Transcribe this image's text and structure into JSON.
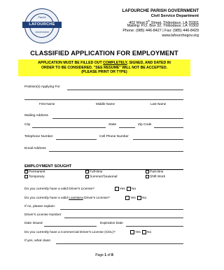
{
  "header": {
    "seal": {
      "top_text": "Parish",
      "band_text": "LAFOURCHE",
      "bottom_text": "Government"
    },
    "org_name": "LAFOURCHE PARISH GOVERNMENT",
    "dept": "Civil Service Department",
    "address1": "402 West 5",
    "address1_sup": "th",
    "address1_rest": " Street, Thibodaux, LA 70301",
    "address2": "Mailing: P.O. Box 32, Thibodaux, LA 70302",
    "phone": "Phone: (985) 446-8427 | Fax: (985) 446-8429",
    "web": "www.lafourchegov.org"
  },
  "title": "CLASSIFIED APPLICATION FOR EMPLOYMENT",
  "notice": {
    "line1_a": "APPLICATION MUST BE FILLED OUT ",
    "line1_u": "COMPLETELY",
    "line1_b": ", SIGNED, AND DATED IN",
    "line2": "ORDER TO BE CONSIDERED. \"SEE RESUME\" WILL NOT BE ACCEPTED.",
    "line3": "(PLEASE PRINT OR TYPE)"
  },
  "fields": {
    "positions": "Position(s) Applying For",
    "first_name": "First Name",
    "middle_name": "Middle Name",
    "last_name": "Last Name",
    "mailing_address": "Mailing Address",
    "city": "City",
    "state": "State",
    "zip": "Zip Code",
    "telephone": "Telephone Number",
    "cell": "Cell Phone Number",
    "email": "Email Address"
  },
  "employment": {
    "heading": "EMPLOYMENT SOUGHT",
    "options": [
      "Permanent",
      "Full-time",
      "Part-time",
      "Temporary",
      "Summer/Seasonal",
      "Shift Work"
    ]
  },
  "questions": {
    "q1": "Do you currently have a valid Driver's License?",
    "q2_a": "Do you currently have a valid ",
    "q2_u": "Louisiana",
    "q2_b": " Driver's License?",
    "if_no": "If no, please explain:",
    "license_number": "Driver's License Number",
    "date_issued": "Date Issued",
    "expiration": "Expiration Date",
    "q3": "Do you currently have a Commercial Driver's License (CDL)?",
    "if_yes": "If yes, what class:",
    "yes": "Yes",
    "no": "No"
  },
  "footer": {
    "page_prefix": "Page ",
    "page": "1",
    "of": " of ",
    "total": "8"
  }
}
